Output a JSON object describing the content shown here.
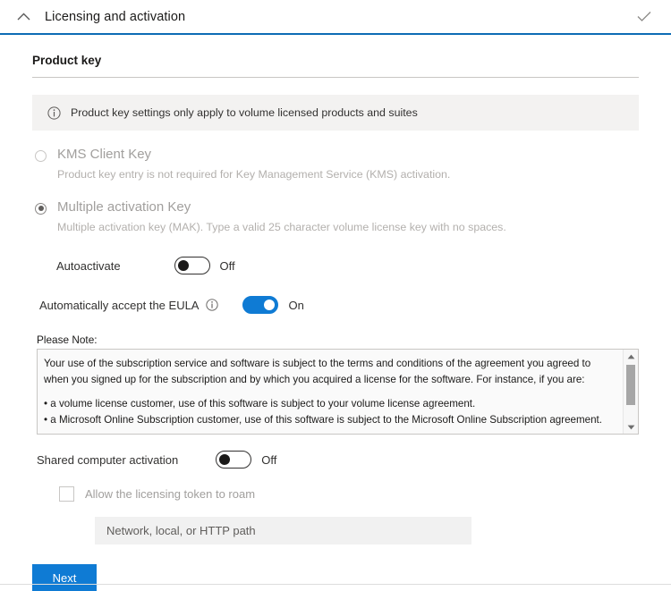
{
  "header": {
    "title": "Licensing and activation",
    "collapse_icon": "chevron-up-icon",
    "confirm_icon": "checkmark-icon",
    "accent_color": "#0d6cb5"
  },
  "section": {
    "title": "Product key"
  },
  "infobar": {
    "icon": "info-icon",
    "text": "Product key settings only apply to volume licensed products and suites"
  },
  "key_options": [
    {
      "label": "KMS Client Key",
      "description": "Product key entry is not required for Key Management Service (KMS) activation.",
      "selected": false
    },
    {
      "label": "Multiple activation Key",
      "description": "Multiple activation key (MAK). Type a valid 25 character volume license key with no spaces.",
      "selected": true
    }
  ],
  "autoactivate": {
    "label": "Autoactivate",
    "state": "Off",
    "on": false
  },
  "eula": {
    "label": "Automatically accept the EULA",
    "info_icon": "info-icon",
    "state": "On",
    "on": true
  },
  "note": {
    "label": "Please Note:",
    "paragraph1": "Your use of the subscription service and software is subject to the terms and conditions of the agreement you agreed to when you signed up for the subscription and by which you acquired a license for the software. For instance, if you are:",
    "bullet1": "• a volume license customer, use of this software is subject to your volume license agreement.",
    "bullet2": "• a Microsoft Online Subscription customer, use of this software is subject to the Microsoft Online Subscription agreement.",
    "scroll_up_icon": "scroll-up-arrow-icon",
    "scroll_down_icon": "scroll-down-arrow-icon"
  },
  "shared_activation": {
    "label": "Shared computer activation",
    "state": "Off",
    "on": false
  },
  "roam_token": {
    "label": "Allow the licensing token to roam",
    "checked": false
  },
  "path_field": {
    "placeholder": "Network, local, or HTTP path",
    "value": ""
  },
  "footer": {
    "next_label": "Next",
    "button_color": "#0f7bd4"
  }
}
